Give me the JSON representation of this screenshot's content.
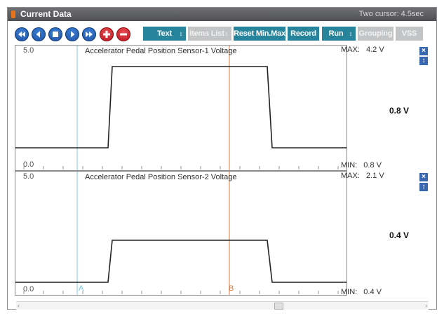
{
  "window": {
    "title": "Current Data",
    "cursor_info": "Two cursor: 4.5sec"
  },
  "toolbar": {
    "nav_buttons": [
      {
        "name": "first-icon"
      },
      {
        "name": "previous-icon"
      },
      {
        "name": "stop-icon"
      },
      {
        "name": "next-icon"
      },
      {
        "name": "last-icon"
      },
      {
        "name": "zoom-in-icon"
      },
      {
        "name": "zoom-out-icon"
      }
    ],
    "text_label": "Text",
    "items_list_label": "Items List",
    "reset_label": "Reset Min.Max",
    "record_label": "Record",
    "run_label": "Run",
    "grouping_label": "Grouping",
    "vss_label": "VSS",
    "spin_glyph": "↕"
  },
  "graphs": [
    {
      "title": "Accelerator Pedal Position Sensor-1 Voltage",
      "y_top_label": "5.0",
      "y_bottom_label": "0.0",
      "max_label": "MAX:",
      "max_value": "4.2 V",
      "min_label": "MIN:",
      "min_value": "0.8 V",
      "current_value": "0.8 V",
      "close_glyph": "×",
      "expand_glyph": "↕"
    },
    {
      "title": "Accelerator Pedal Position Sensor-2 Voltage",
      "y_top_label": "5.0",
      "y_bottom_label": "0.0",
      "max_label": "MAX:",
      "max_value": "2.1 V",
      "min_label": "MIN:",
      "min_value": "0.4 V",
      "current_value": "0.4 V",
      "close_glyph": "×",
      "expand_glyph": "↕"
    }
  ],
  "cursors": {
    "a_label": "A",
    "b_label": "B",
    "a_color": "#7fc8e8",
    "b_color": "#e07a3a"
  },
  "scrollbar": {
    "left_arrow": "‹",
    "right_arrow": "›"
  },
  "colors": {
    "toolbar_button": "#28849b",
    "nav_circle": "#2a62b8",
    "zoom_circle": "#d42a33",
    "trace": "#222222"
  }
}
